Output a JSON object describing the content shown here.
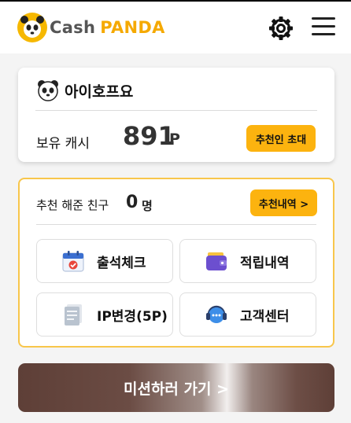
{
  "app": {
    "logo_cash": "Cash",
    "logo_panda": "PANDA",
    "brand_color": "#f5a900"
  },
  "header": {
    "settings_icon": "gear-icon",
    "menu_icon": "hamburger-menu-icon"
  },
  "profile": {
    "avatar_icon": "panda-avatar-icon",
    "username": "아이호프요",
    "cash_label": "보유 캐시",
    "cash_value": "891",
    "cash_unit": "P",
    "invite_button": "추천인 초대"
  },
  "referral": {
    "friends_label": "추천 해준 친구",
    "friends_count": "0",
    "friends_unit": "명",
    "history_button": "추천내역 >"
  },
  "tiles": [
    {
      "label": "출석체크",
      "icon": "calendar-check-icon"
    },
    {
      "label": "적립내역",
      "icon": "wallet-icon"
    },
    {
      "label": "IP변경(5P)",
      "icon": "document-icon"
    },
    {
      "label": "고객센터",
      "icon": "headset-chat-icon"
    }
  ],
  "mission": {
    "button_label": "미션하러 가기 >"
  },
  "colors": {
    "accent_button": "#fcb30f",
    "card_border": "#f8c64b",
    "mission_button": "#5e3f37"
  }
}
